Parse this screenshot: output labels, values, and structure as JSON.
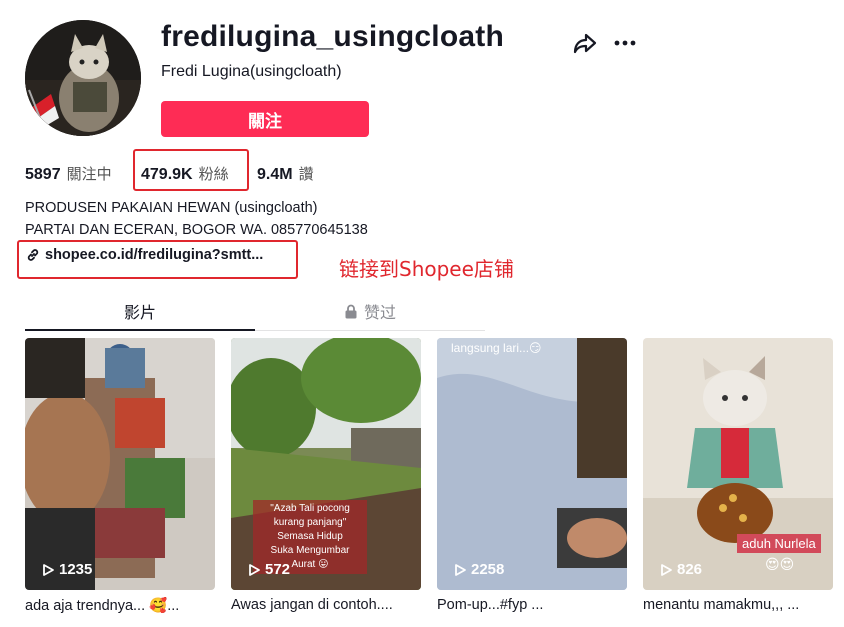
{
  "profile": {
    "username": "fredilugina_usingcloath",
    "nickname": "Fredi Lugina(usingcloath)",
    "follow_label": "關注",
    "stats": [
      {
        "value": "5897",
        "label": "關注中"
      },
      {
        "value": "479.9K",
        "label": "粉絲"
      },
      {
        "value": "9.4M",
        "label": "讚"
      }
    ],
    "bio_lines": [
      "PRODUSEN PAKAIAN HEWAN (usingcloath)",
      "PARTAI DAN ECERAN, BOGOR WA. 085770645138"
    ],
    "link": "shopee.co.id/fredilugina?smtt..."
  },
  "annotation": "链接到Shopee店铺",
  "tabs": {
    "videos_label": "影片",
    "liked_label": "赞过"
  },
  "videos": [
    {
      "views": "1235",
      "caption": "ada aja trendnya... 🥰..."
    },
    {
      "views": "572",
      "caption": "Awas jangan di contoh....",
      "overlay": [
        "\"Azab Tali pocong",
        "kurang panjang\"",
        "Semasa Hidup",
        "Suka Mengumbar",
        "Aurat 😛"
      ]
    },
    {
      "views": "2258",
      "caption": "Pom-up...#fyp ...",
      "overlay_top": "langsung lari...😏"
    },
    {
      "views": "826",
      "caption": "menantu mamakmu,,, ...",
      "overlay_tag": "aduh Nurlela",
      "overlay_emoji": "😍😍"
    }
  ],
  "colors": {
    "accent": "#fe2c55",
    "highlight": "#e0272e",
    "text": "#161823"
  }
}
